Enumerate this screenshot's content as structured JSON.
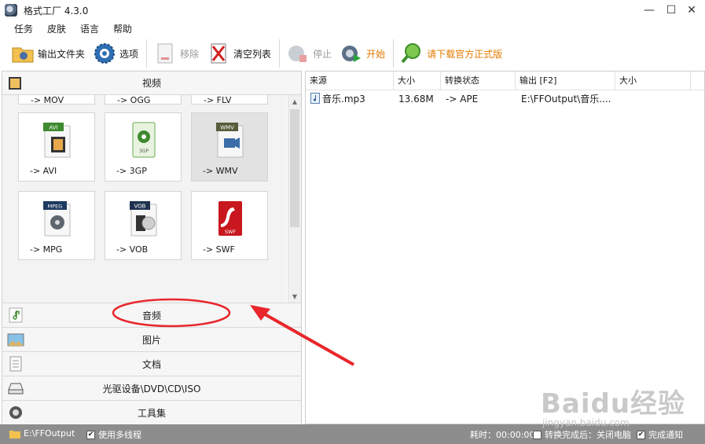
{
  "window": {
    "title": "格式工厂 4.3.0",
    "controls": [
      "—",
      "☐",
      "✕"
    ]
  },
  "menu": [
    "任务",
    "皮肤",
    "语言",
    "帮助"
  ],
  "toolbar": {
    "output_folder": "输出文件夹",
    "options": "选项",
    "remove": "移除",
    "clear_list": "清空列表",
    "stop": "停止",
    "start": "开始",
    "download": "请下载官方正式版"
  },
  "left_panel": {
    "video_header": "视频",
    "top_row_labels": [
      "-> MOV",
      "-> OGG",
      "-> FLV"
    ],
    "formats": [
      {
        "badge": "AVI",
        "label": "-> AVI"
      },
      {
        "badge": "3GP",
        "label": "-> 3GP"
      },
      {
        "badge": "WMV",
        "label": "-> WMV"
      },
      {
        "badge": "MPEG",
        "label": "-> MPG"
      },
      {
        "badge": "VOB",
        "label": "-> VOB"
      },
      {
        "badge": "SWF",
        "label": "-> SWF"
      }
    ],
    "categories": [
      "音频",
      "图片",
      "文档",
      "光驱设备\\DVD\\CD\\ISO",
      "工具集"
    ]
  },
  "task_list": {
    "columns": [
      "来源",
      "大小",
      "转换状态",
      "输出 [F2]",
      "大小"
    ],
    "rows": [
      {
        "source": "音乐.mp3",
        "size": "13.68M",
        "status": "-> APE",
        "output": "E:\\FFOutput\\音乐....",
        "out_size": ""
      }
    ]
  },
  "statusbar": {
    "output_path": "E:\\FFOutput",
    "multithread": "使用多线程",
    "elapsed": "耗时：00:00:00",
    "after_done": "转换完成后：关闭电脑",
    "notify": "完成通知"
  },
  "watermark": {
    "brand": "Baidu经验",
    "url": "jingyan.baidu.com"
  },
  "colors": {
    "annotation_red": "#e8262c",
    "accent_orange": "#e37b00",
    "statusbar_bg": "#8d8d8d"
  }
}
